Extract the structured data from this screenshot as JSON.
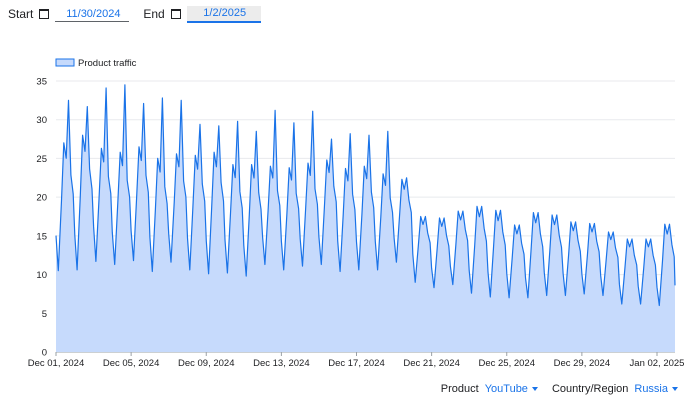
{
  "controls": {
    "start_label": "Start",
    "start_value": "11/30/2024",
    "end_label": "End",
    "end_value": "1/2/2025",
    "product_label": "Product",
    "product_value": "YouTube",
    "country_label": "Country/Region",
    "country_value": "Russia"
  },
  "chart_data": {
    "type": "area",
    "title": "",
    "xlabel": "",
    "ylabel": "",
    "ylim": [
      0,
      35
    ],
    "yticks": [
      0,
      5,
      10,
      15,
      20,
      25,
      30,
      35
    ],
    "xlim": [
      "2024-12-01T00:00",
      "2025-01-02T23:00"
    ],
    "xticks": [
      {
        "date": "2024-12-01",
        "label": "Dec 01, 2024"
      },
      {
        "date": "2024-12-05",
        "label": "Dec 05, 2024"
      },
      {
        "date": "2024-12-09",
        "label": "Dec 09, 2024"
      },
      {
        "date": "2024-12-13",
        "label": "Dec 13, 2024"
      },
      {
        "date": "2024-12-17",
        "label": "Dec 17, 2024"
      },
      {
        "date": "2024-12-21",
        "label": "Dec 21, 2024"
      },
      {
        "date": "2024-12-25",
        "label": "Dec 25, 2024"
      },
      {
        "date": "2024-12-29",
        "label": "Dec 29, 2024"
      },
      {
        "date": "2025-01-02",
        "label": "Jan 02, 2025"
      }
    ],
    "legend": "top-left",
    "grid": "horizontal",
    "colors": {
      "line": "#1a73e8",
      "fill": "#c6dafc",
      "legend_fill": "#c6dafc",
      "legend_line": "#1a73e8"
    },
    "series": [
      {
        "name": "Product traffic",
        "daily_profile": [
          {
            "date": "2024-12-01",
            "low": 10.5,
            "high": 27.0,
            "peak": 32.5
          },
          {
            "date": "2024-12-02",
            "low": 10.6,
            "high": 28.0,
            "peak": 31.7
          },
          {
            "date": "2024-12-03",
            "low": 11.7,
            "high": 26.3,
            "peak": 34.1
          },
          {
            "date": "2024-12-04",
            "low": 11.3,
            "high": 25.8,
            "peak": 34.5
          },
          {
            "date": "2024-12-05",
            "low": 11.8,
            "high": 26.5,
            "peak": 32.1
          },
          {
            "date": "2024-12-06",
            "low": 10.4,
            "high": 25.0,
            "peak": 32.8
          },
          {
            "date": "2024-12-07",
            "low": 11.6,
            "high": 25.6,
            "peak": 32.5
          },
          {
            "date": "2024-12-08",
            "low": 10.6,
            "high": 25.4,
            "peak": 29.4
          },
          {
            "date": "2024-12-09",
            "low": 10.1,
            "high": 25.8,
            "peak": 29.2
          },
          {
            "date": "2024-12-10",
            "low": 10.2,
            "high": 24.2,
            "peak": 29.8
          },
          {
            "date": "2024-12-11",
            "low": 9.8,
            "high": 24.2,
            "peak": 28.5
          },
          {
            "date": "2024-12-12",
            "low": 11.3,
            "high": 24.0,
            "peak": 31.2
          },
          {
            "date": "2024-12-13",
            "low": 10.6,
            "high": 23.8,
            "peak": 29.6
          },
          {
            "date": "2024-12-14",
            "low": 11.1,
            "high": 24.4,
            "peak": 31.1
          },
          {
            "date": "2024-12-15",
            "low": 11.3,
            "high": 24.8,
            "peak": 27.5
          },
          {
            "date": "2024-12-16",
            "low": 10.4,
            "high": 23.7,
            "peak": 28.2
          },
          {
            "date": "2024-12-17",
            "low": 10.6,
            "high": 24.0,
            "peak": 28.0
          },
          {
            "date": "2024-12-18",
            "low": 10.6,
            "high": 23.0,
            "peak": 28.5
          },
          {
            "date": "2024-12-19",
            "low": 11.6,
            "high": 22.3,
            "peak": 22.5
          },
          {
            "date": "2024-12-20",
            "low": 9.0,
            "high": 17.5,
            "peak": 17.5
          },
          {
            "date": "2024-12-21",
            "low": 8.3,
            "high": 17.3,
            "peak": 17.3
          },
          {
            "date": "2024-12-22",
            "low": 8.7,
            "high": 18.2,
            "peak": 18.2
          },
          {
            "date": "2024-12-23",
            "low": 7.6,
            "high": 18.8,
            "peak": 18.8
          },
          {
            "date": "2024-12-24",
            "low": 7.1,
            "high": 18.3,
            "peak": 18.3
          },
          {
            "date": "2024-12-25",
            "low": 7.0,
            "high": 16.4,
            "peak": 16.4
          },
          {
            "date": "2024-12-26",
            "low": 7.0,
            "high": 18.0,
            "peak": 18.0
          },
          {
            "date": "2024-12-27",
            "low": 7.3,
            "high": 17.7,
            "peak": 17.7
          },
          {
            "date": "2024-12-28",
            "low": 7.3,
            "high": 16.8,
            "peak": 16.8
          },
          {
            "date": "2024-12-29",
            "low": 7.5,
            "high": 16.6,
            "peak": 16.6
          },
          {
            "date": "2024-12-30",
            "low": 7.3,
            "high": 15.5,
            "peak": 15.5
          },
          {
            "date": "2024-12-31",
            "low": 6.2,
            "high": 14.6,
            "peak": 14.6
          },
          {
            "date": "2025-01-01",
            "low": 6.2,
            "high": 14.6,
            "peak": 14.6
          },
          {
            "date": "2025-01-02",
            "low": 6.0,
            "high": 16.5,
            "peak": 16.5
          }
        ],
        "last_value": 8.6
      }
    ]
  }
}
